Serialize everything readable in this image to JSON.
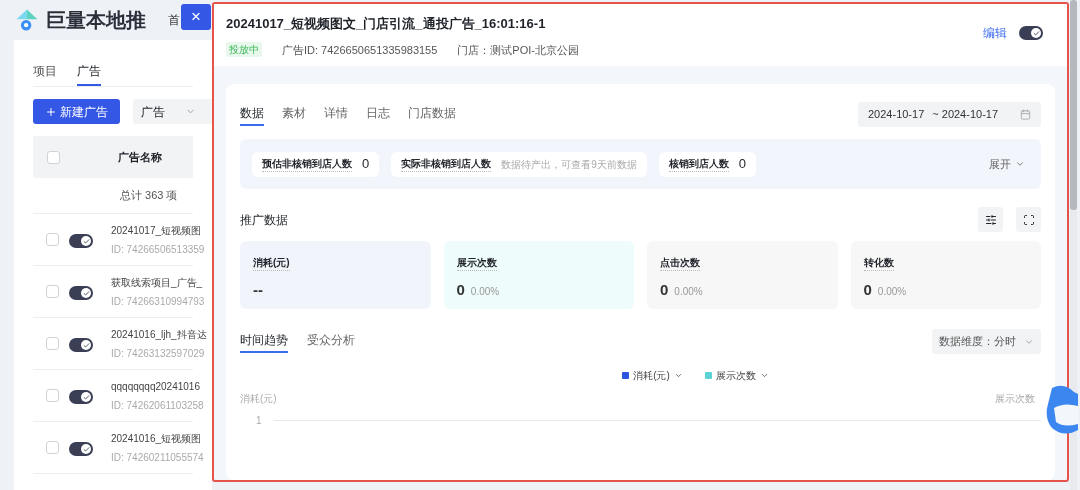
{
  "header": {
    "brand": "巨量本地推",
    "nav_item": "首",
    "close": "×"
  },
  "left_tabs": [
    {
      "label": "项目",
      "selected": false
    },
    {
      "label": "广告",
      "selected": true
    }
  ],
  "new_button": "新建广告",
  "filter_select": "广告",
  "table": {
    "all_checked": false,
    "column": "广告名称",
    "total": "总计 363 项",
    "rows": [
      {
        "name": "20241017_短视频图",
        "id": "ID: 74266506513359",
        "on": true,
        "checked": false
      },
      {
        "name": "获取线索项目_广告_",
        "id": "ID: 74266310994793",
        "on": true,
        "checked": false
      },
      {
        "name": "20241016_ljh_抖音达",
        "id": "ID: 74263132597029",
        "on": true,
        "checked": false
      },
      {
        "name": "qqqqqqqq20241016",
        "id": "ID: 74262061103258",
        "on": true,
        "checked": false
      },
      {
        "name": "20241016_短视频图",
        "id": "ID: 74260211055574",
        "on": true,
        "checked": false
      }
    ]
  },
  "drawer": {
    "title": "20241017_短视频图文_门店引流_通投广告_16:01:16-1",
    "status": "投放中",
    "ad_id": "广告ID: 7426650651335983155",
    "store": "门店：测试POI-北京公园",
    "edit": "编辑",
    "on": true,
    "tabs": [
      {
        "label": "数据",
        "selected": true
      },
      {
        "label": "素材",
        "selected": false
      },
      {
        "label": "详情",
        "selected": false
      },
      {
        "label": "日志",
        "selected": false
      },
      {
        "label": "门店数据",
        "selected": false
      }
    ],
    "date_start": "2024-10-17",
    "date_end": "~ 2024-10-17",
    "chips": [
      {
        "label": "预估非核销到店人数",
        "value": "0",
        "kind": "value"
      },
      {
        "label": "实际非核销到店人数",
        "value": "数据待产出，可查看9天前数据",
        "kind": "note"
      },
      {
        "label": "核销到店人数",
        "value": "0",
        "kind": "value"
      }
    ],
    "expand": "展开",
    "section_title": "推广数据",
    "metrics": [
      {
        "label": "消耗(元)",
        "value": "--",
        "color": "#f1f4fb"
      },
      {
        "label": "展示次数",
        "value": "0",
        "percent": "0.00%",
        "color": "#effcfc"
      },
      {
        "label": "点击次数",
        "value": "0",
        "percent": "0.00%",
        "color": "#f7f7f7"
      },
      {
        "label": "转化数",
        "value": "0",
        "percent": "0.00%",
        "color": "#f7f7f7"
      }
    ],
    "sub_tabs": [
      {
        "label": "时间趋势",
        "selected": true
      },
      {
        "label": "受众分析",
        "selected": false
      }
    ],
    "dimension": "数据维度：分时",
    "legend": [
      {
        "label": "消耗(元)",
        "color": "#2b55e0"
      },
      {
        "label": "展示次数",
        "color": "#5dd3d8"
      }
    ],
    "axis_left": "消耗(元)",
    "axis_right": "展示次数",
    "tick": "1"
  }
}
